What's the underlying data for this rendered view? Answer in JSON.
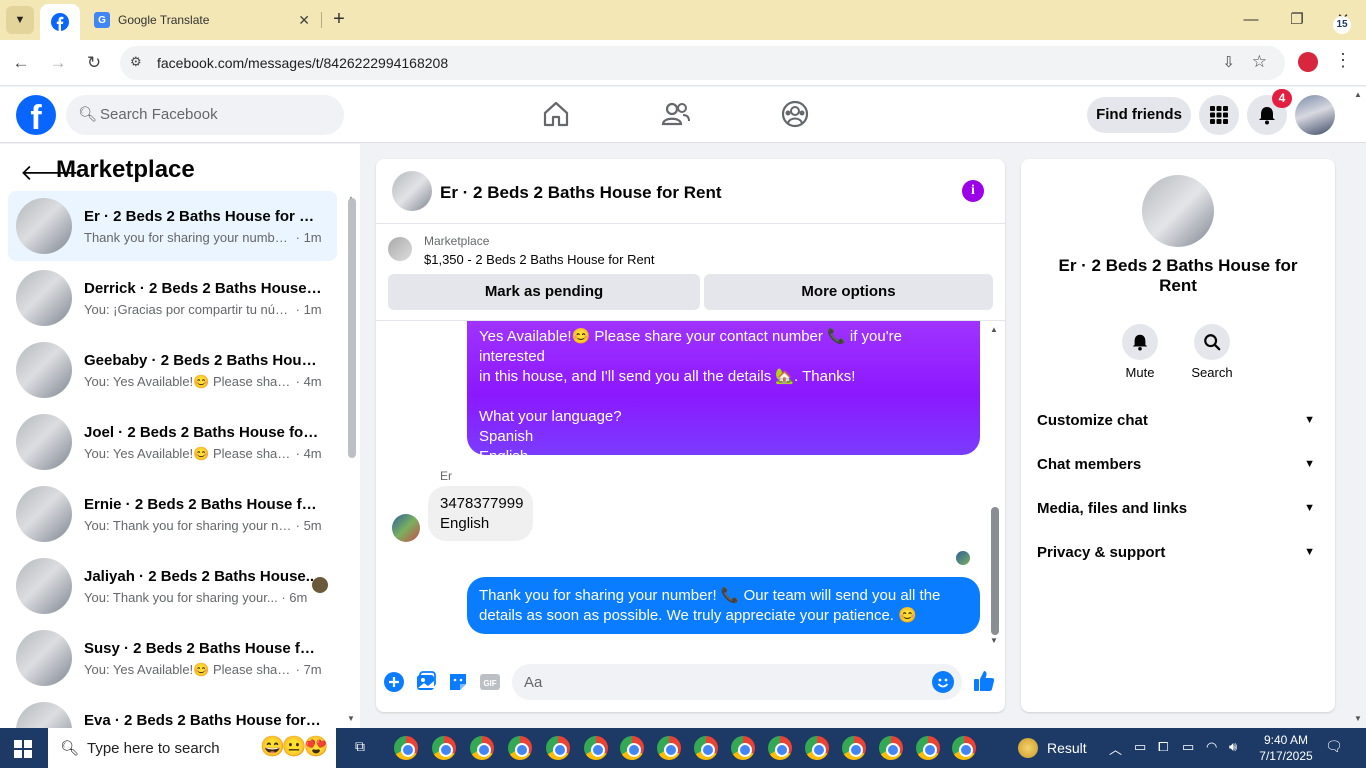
{
  "browser": {
    "tabs": [
      {
        "label": "",
        "icon": "facebook-icon"
      },
      {
        "label": "Google Translate",
        "icon": "google-translate-icon"
      }
    ],
    "url": "facebook.com/messages/t/8426222994168208"
  },
  "fb_header": {
    "search_placeholder": "Search Facebook",
    "find_friends_label": "Find friends",
    "notification_count": "4"
  },
  "sidebar": {
    "title": "Marketplace",
    "conversations": [
      {
        "name": "Er · 2 Beds 2 Baths House for Rent",
        "preview": "Thank you for sharing your numbe...",
        "time": "· 1m",
        "selected": true
      },
      {
        "name": "Derrick · 2 Beds 2 Baths House f...",
        "preview": "You: ¡Gracias por compartir tu núm...",
        "time": "· 1m"
      },
      {
        "name": "Geebaby · 2 Beds 2 Baths House...",
        "preview": "You: Yes Available!😊 Please share ...",
        "time": "· 4m"
      },
      {
        "name": "Joel · 2 Beds 2 Baths House for ...",
        "preview": "You: Yes Available!😊 Please share ...",
        "time": "· 4m"
      },
      {
        "name": "Ernie · 2 Beds 2 Baths House for ...",
        "preview": "You: Thank you for sharing your nu...",
        "time": "· 5m"
      },
      {
        "name": "Jaliyah · 2 Beds 2 Baths House...",
        "preview": "You: Thank you for sharing your...",
        "time": "· 6m"
      },
      {
        "name": "Susy · 2 Beds 2 Baths House for ...",
        "preview": "You: Yes Available!😊 Please share ...",
        "time": "· 7m"
      },
      {
        "name": "Eva · 2 Beds 2 Baths House for R...",
        "preview": "",
        "time": ""
      }
    ]
  },
  "chat": {
    "title": "Er · 2 Beds 2 Baths House for Rent",
    "marketplace_label": "Marketplace",
    "listing": "$1,350 - 2 Beds 2 Baths House for Rent",
    "mark_pending_label": "Mark as pending",
    "more_options_label": "More options",
    "messages": {
      "out1_line1": "Yes Available!😊 Please share your contact number 📞 if you're interested",
      "out1_line2": "in this house, and I'll send you all the details 🏡. Thanks!",
      "out1_line3": "What your language?",
      "out1_line4": "Spanish",
      "out1_line5": "English",
      "sender": "Er",
      "in1_line1": "3478377999",
      "in1_line2": "English",
      "out2_line1": "Thank you for sharing your number! 📞 Our team will send you all the",
      "out2_line2": "details as soon as possible. We truly appreciate your patience. 😊"
    },
    "composer_placeholder": "Aa"
  },
  "info_panel": {
    "name": "Er · 2 Beds 2 Baths House for Rent",
    "mute_label": "Mute",
    "search_label": "Search",
    "sections": [
      "Customize chat",
      "Chat members",
      "Media, files and links",
      "Privacy & support"
    ]
  },
  "taskbar": {
    "search_placeholder": "Type here to search",
    "weather_label": "Result",
    "time": "9:40 AM",
    "date": "7/17/2025",
    "notification_count": "15"
  },
  "colors": {
    "fb_blue": "#0866ff",
    "messenger_purple": "#9b00e8",
    "bubble_blue": "#0a7cff",
    "selected_row": "#ebf5ff",
    "badge_red": "#e41e3f"
  }
}
